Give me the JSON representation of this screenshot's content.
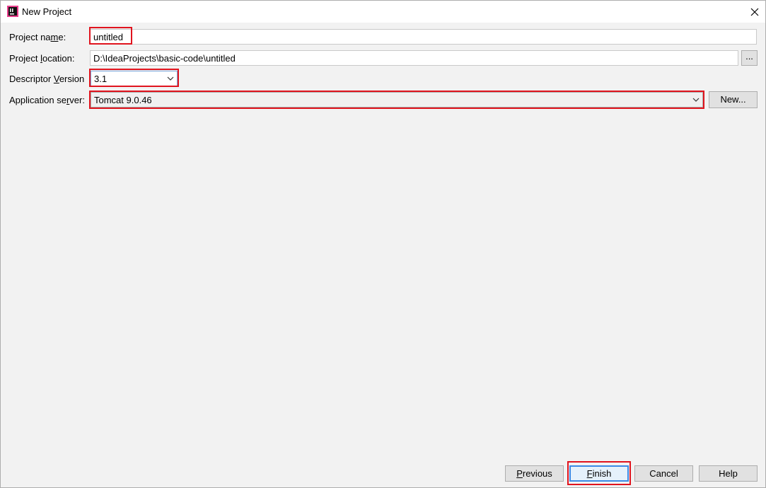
{
  "window": {
    "title": "New Project"
  },
  "form": {
    "project_name": {
      "label_pre": "Project na",
      "label_mn": "m",
      "label_post": "e:",
      "value": "untitled"
    },
    "project_location": {
      "label_pre": "Project ",
      "label_mn": "l",
      "label_post": "ocation:",
      "value": "D:\\IdeaProjects\\basic-code\\untitled",
      "browse_label": "..."
    },
    "descriptor_version": {
      "label_pre": "Descriptor ",
      "label_mn": "V",
      "label_post": "ersion",
      "value": "3.1"
    },
    "application_server": {
      "label_pre": "Application se",
      "label_mn": "r",
      "label_post": "ver:",
      "value": "Tomcat 9.0.46",
      "new_label": "New..."
    }
  },
  "buttons": {
    "previous": {
      "mn": "P",
      "rest": "revious"
    },
    "finish": {
      "mn": "F",
      "rest": "inish"
    },
    "cancel": "Cancel",
    "help": "Help"
  },
  "colors": {
    "highlight": "#e0141e",
    "primary_border": "#3c8ae5"
  }
}
